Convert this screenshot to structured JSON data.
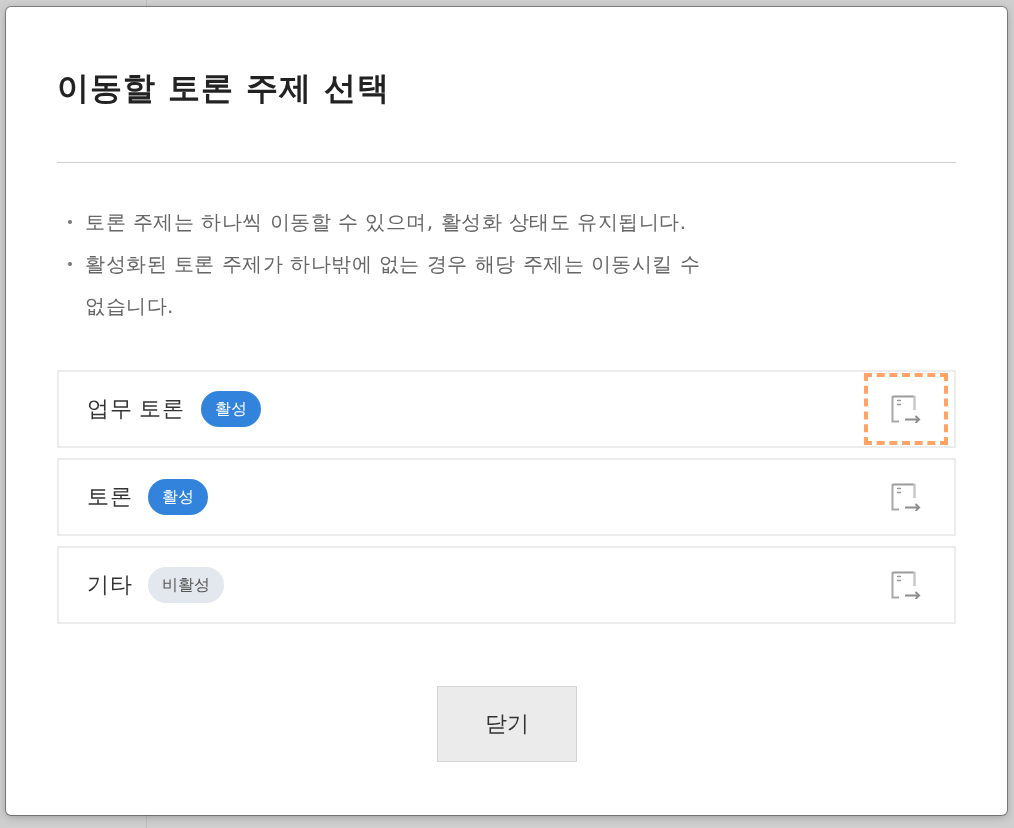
{
  "dialog": {
    "title": "이동할 토론 주제 선택",
    "notes": [
      "토론 주제는 하나씩 이동할 수 있으며, 활성화 상태도 유지됩니다.",
      "활성화된 토론 주제가 하나밖에 없는 경우 해당 주제는 이동시킬 수 없습니다."
    ],
    "topics": [
      {
        "name": "업무 토론",
        "status": "활성",
        "active": true,
        "focused": true
      },
      {
        "name": "토론",
        "status": "활성",
        "active": true,
        "focused": false
      },
      {
        "name": "기타",
        "status": "비활성",
        "active": false,
        "focused": false
      }
    ],
    "buttons": [
      {
        "label": "닫기"
      }
    ]
  }
}
